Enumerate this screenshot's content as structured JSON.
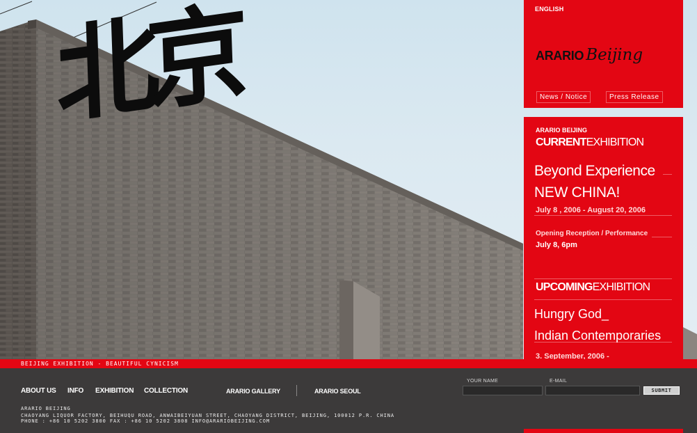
{
  "header": {
    "language_link": "ENGLISH",
    "logo": {
      "part1": "ARARIO",
      "part2": "Beijing"
    },
    "links": {
      "news": "News / Notice",
      "press": "Press Release"
    }
  },
  "hero": {
    "calligraphy": "北京",
    "icon": "brick-wall-photo"
  },
  "exhibition": {
    "org": "ARARIO BEIJING",
    "current": {
      "strong": "CURRENT",
      "light": "EXHIBITION"
    },
    "current_title_line1": "Beyond Experience",
    "current_title_line2": "NEW CHINA!",
    "current_dates": "July 8 , 2006 - August 20, 2006",
    "opening_label": "Opening Reception / Performance",
    "opening_date": "July 8, 6pm",
    "upcoming": {
      "strong": "UPCOMING",
      "light": "EXHIBITION"
    },
    "upcoming_title_line1": "Hungry God_",
    "upcoming_title_line2": "Indian Contemporaries",
    "upcoming_date": "3. September, 2006 -"
  },
  "footer": {
    "tagline": "BEIJING EXHIBITION - BEAUTIFUL CYNICISM",
    "nav": {
      "about": "ABOUT US",
      "info": "INFO",
      "exhibition": "EXHIBITION",
      "collection": "COLLECTION"
    },
    "sub_nav": {
      "gallery": "ARARIO GALLERY",
      "seoul": "ARARIO SEOUL"
    },
    "form": {
      "name_label": "YOUR NAME",
      "email_label": "E-MAIL",
      "name_value": "",
      "email_value": "",
      "submit": "SUBMIT"
    },
    "address": {
      "name": "ARARIO BEIJING",
      "street": "CHAOYANG LIQUOR FACTORY, BEIHUQU ROAD, ANWAIBEIYUAN STREET, CHAOYANG DISTRICT, BEIJING, 100012 P.R. CHINA",
      "phone": "PHONE : +86 10 5202 3800 FAX  : +86 10 5202 3808 INFO@ARARIOBEIJING.COM"
    }
  },
  "colors": {
    "brand_red": "#e30613",
    "footer_gray": "#3c3a3a",
    "sky": "#dbe9f1",
    "brick": "#7b7671"
  }
}
